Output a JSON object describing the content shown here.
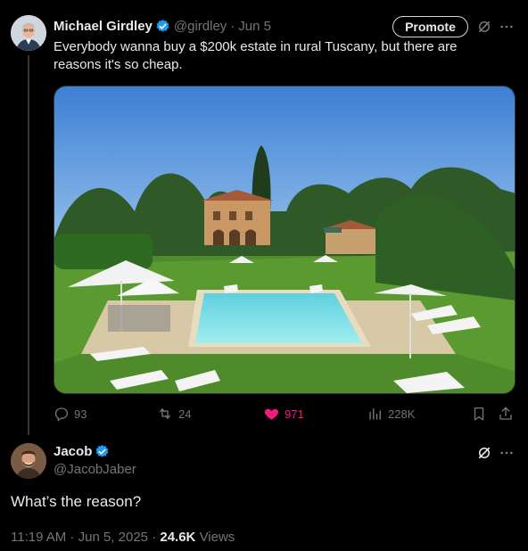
{
  "tweet": {
    "author_name": "Michael Girdley",
    "author_handle": "@girdley",
    "separator": "·",
    "date": "Jun 5",
    "text": "Everybody wanna buy a $200k estate in rural Tuscany, but there are reasons it's so cheap.",
    "promote_label": "Promote",
    "stats": {
      "replies": "93",
      "reposts": "24",
      "likes": "971",
      "views": "228K"
    },
    "media_icon": "villa-pool-photo"
  },
  "reply": {
    "author_name": "Jacob",
    "author_handle": "@JacobJaber",
    "text": "What’s the reason?",
    "time": "11:19 AM",
    "date": "Jun 5, 2025",
    "views_count": "24.6K",
    "views_label": "Views",
    "separator": "·"
  },
  "colors": {
    "background": "#000000",
    "text": "#e7e9ea",
    "muted": "#71767b",
    "verified": "#1d9bf0",
    "like": "#f91880"
  }
}
